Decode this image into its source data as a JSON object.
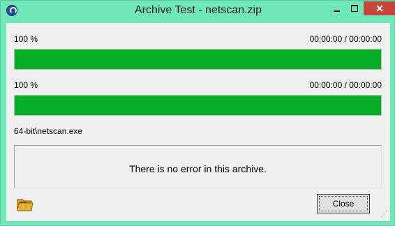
{
  "window": {
    "title": "Archive Test - netscan.zip"
  },
  "progress1": {
    "percent_label": "100 %",
    "time_label": "00:00:00 / 00:00:00",
    "value": 1.0
  },
  "progress2": {
    "percent_label": "100 %",
    "time_label": "00:00:00 / 00:00:00",
    "value": 1.0
  },
  "current_file": "64-bit\\netscan.exe",
  "message": "There is no error in this archive.",
  "buttons": {
    "close_label": "Close"
  },
  "icons": {
    "app": "winrar-icon",
    "folder": "folder-icon",
    "minimize": "minimize-icon",
    "maximize": "maximize-icon",
    "close": "close-icon"
  },
  "colors": {
    "progress_fill": "#06b025",
    "titlebar": "#6fe8b8",
    "close_button": "#c7453a"
  }
}
